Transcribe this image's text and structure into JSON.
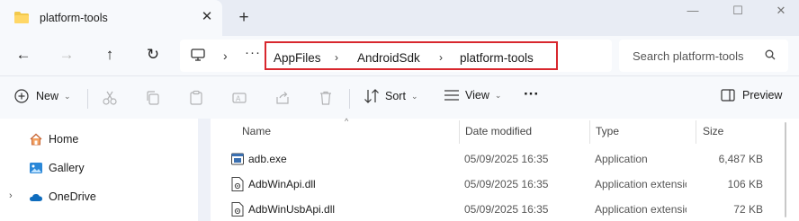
{
  "tab": {
    "title": "platform-tools",
    "close": "✕"
  },
  "new_tab": "+",
  "window_controls": {
    "minimize": "—",
    "maximize": "☐",
    "close": "✕"
  },
  "nav": {
    "back": "←",
    "forward": "→",
    "up": "↑",
    "refresh": "↻",
    "more": "···"
  },
  "breadcrumb": [
    "AppFiles",
    "AndroidSdk",
    "platform-tools"
  ],
  "search": {
    "placeholder": "Search platform-tools"
  },
  "toolbar": {
    "new_label": "New",
    "sort_label": "Sort",
    "view_label": "View",
    "more": "···",
    "preview_label": "Preview"
  },
  "sidebar": {
    "items": [
      {
        "label": "Home",
        "icon": "home-icon"
      },
      {
        "label": "Gallery",
        "icon": "gallery-icon"
      },
      {
        "label": "OneDrive",
        "icon": "cloud-icon"
      }
    ]
  },
  "columns": {
    "name": "Name",
    "date": "Date modified",
    "type": "Type",
    "size": "Size"
  },
  "files": [
    {
      "name": "adb.exe",
      "date": "05/09/2025 16:35",
      "type": "Application",
      "size": "6,487 KB"
    },
    {
      "name": "AdbWinApi.dll",
      "date": "05/09/2025 16:35",
      "type": "Application extension",
      "size": "106 KB"
    },
    {
      "name": "AdbWinUsbApi.dll",
      "date": "05/09/2025 16:35",
      "type": "Application extension",
      "size": "72 KB"
    }
  ],
  "colors": {
    "highlight_box": "#d8272e",
    "folder": "#f2c94c",
    "accent": "#0067c0"
  }
}
